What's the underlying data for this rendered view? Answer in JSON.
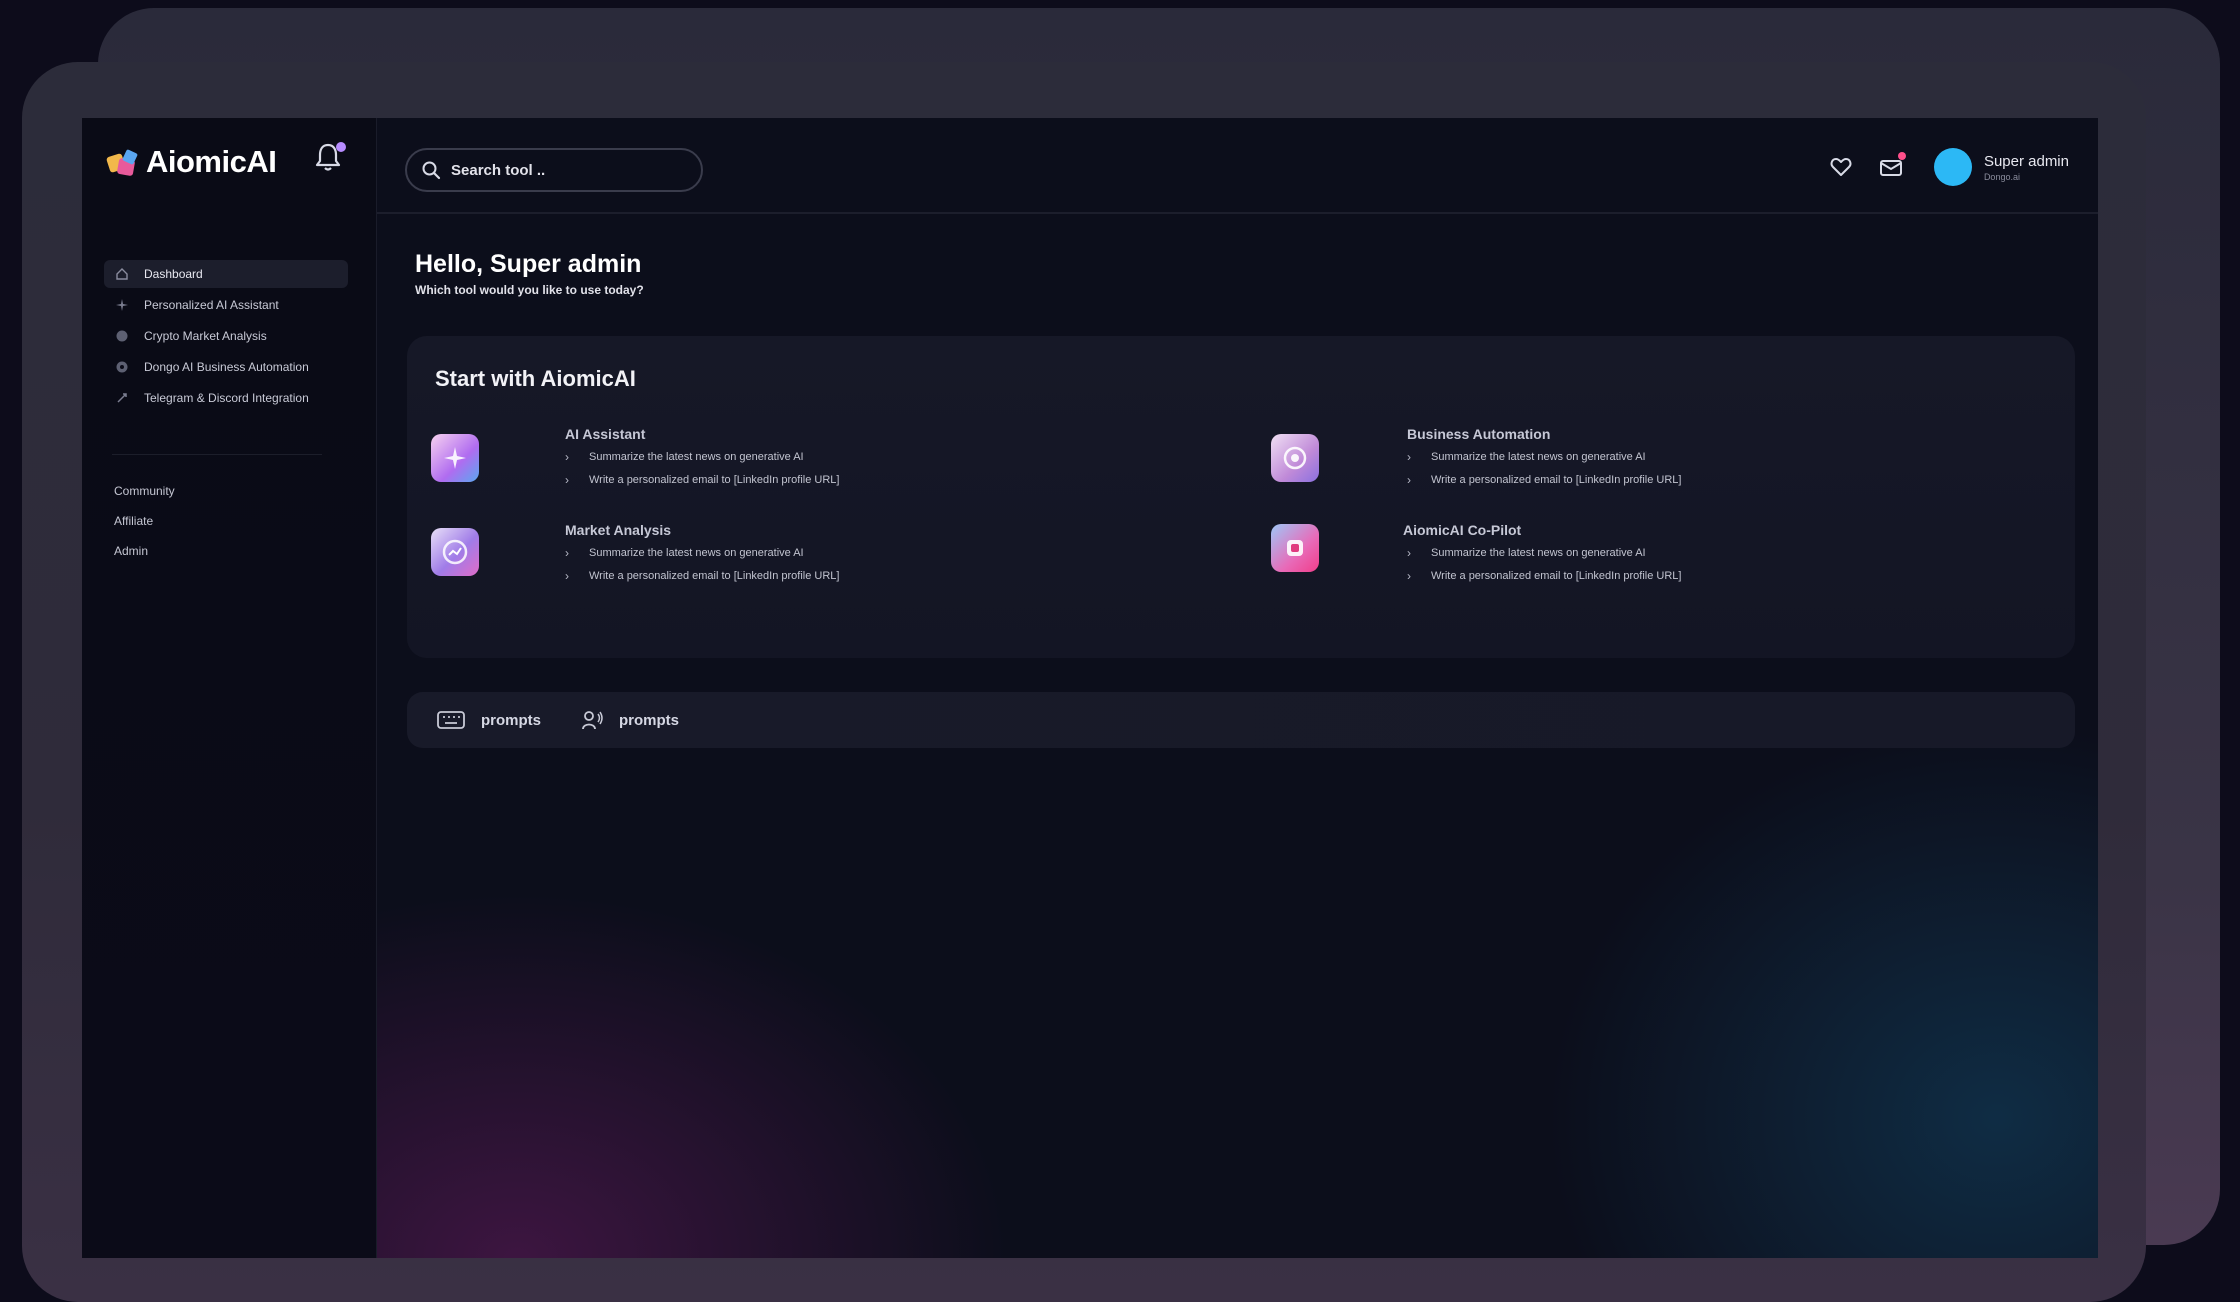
{
  "app": {
    "logo_text": "AiomicAI"
  },
  "sidebar": {
    "items": [
      {
        "label": "Dashboard",
        "icon": "home-icon",
        "active": true
      },
      {
        "label": "Personalized AI Assistant",
        "icon": "sparkle-icon",
        "active": false
      },
      {
        "label": "Crypto Market Analysis",
        "icon": "coin-icon",
        "active": false
      },
      {
        "label": "Dongo AI Business Automation",
        "icon": "gear-icon",
        "active": false
      },
      {
        "label": "Telegram & Discord Integration",
        "icon": "link-icon",
        "active": false
      }
    ],
    "secondary": [
      {
        "label": "Community"
      },
      {
        "label": "Affiliate"
      },
      {
        "label": "Admin"
      }
    ]
  },
  "header": {
    "search_placeholder": "Search tool ..",
    "user_name": "Super admin",
    "user_sub": "Dongo.ai"
  },
  "greeting": {
    "title": "Hello, Super admin",
    "subtitle": "Which tool would you like to use today?"
  },
  "start": {
    "title": "Start with AiomicAI",
    "tools": [
      {
        "name": "AI Assistant",
        "icon": "sparkle-icon",
        "lines": [
          "Summarize the latest news on generative AI",
          "Write a personalized email to [LinkedIn profile URL]"
        ]
      },
      {
        "name": "Business Automation",
        "icon": "gear-icon",
        "lines": [
          "Summarize the latest news on generative AI",
          "Write a personalized email to [LinkedIn profile URL]"
        ]
      },
      {
        "name": "Market Analysis",
        "icon": "chart-icon",
        "lines": [
          "Summarize the latest news on generative AI",
          "Write a personalized email to [LinkedIn profile URL]"
        ]
      },
      {
        "name": "AiomicAI  Co-Pilot",
        "icon": "copilot-icon",
        "lines": [
          "Summarize the latest news on generative AI",
          "Write a personalized email to [LinkedIn profile URL]"
        ]
      }
    ]
  },
  "prompts": {
    "keyboard_label": "prompts",
    "voice_label": "prompts"
  },
  "colors": {
    "avatar": "#2cb8f5",
    "accent_pink": "#ff4f8b",
    "accent_purple": "#b78cff"
  }
}
